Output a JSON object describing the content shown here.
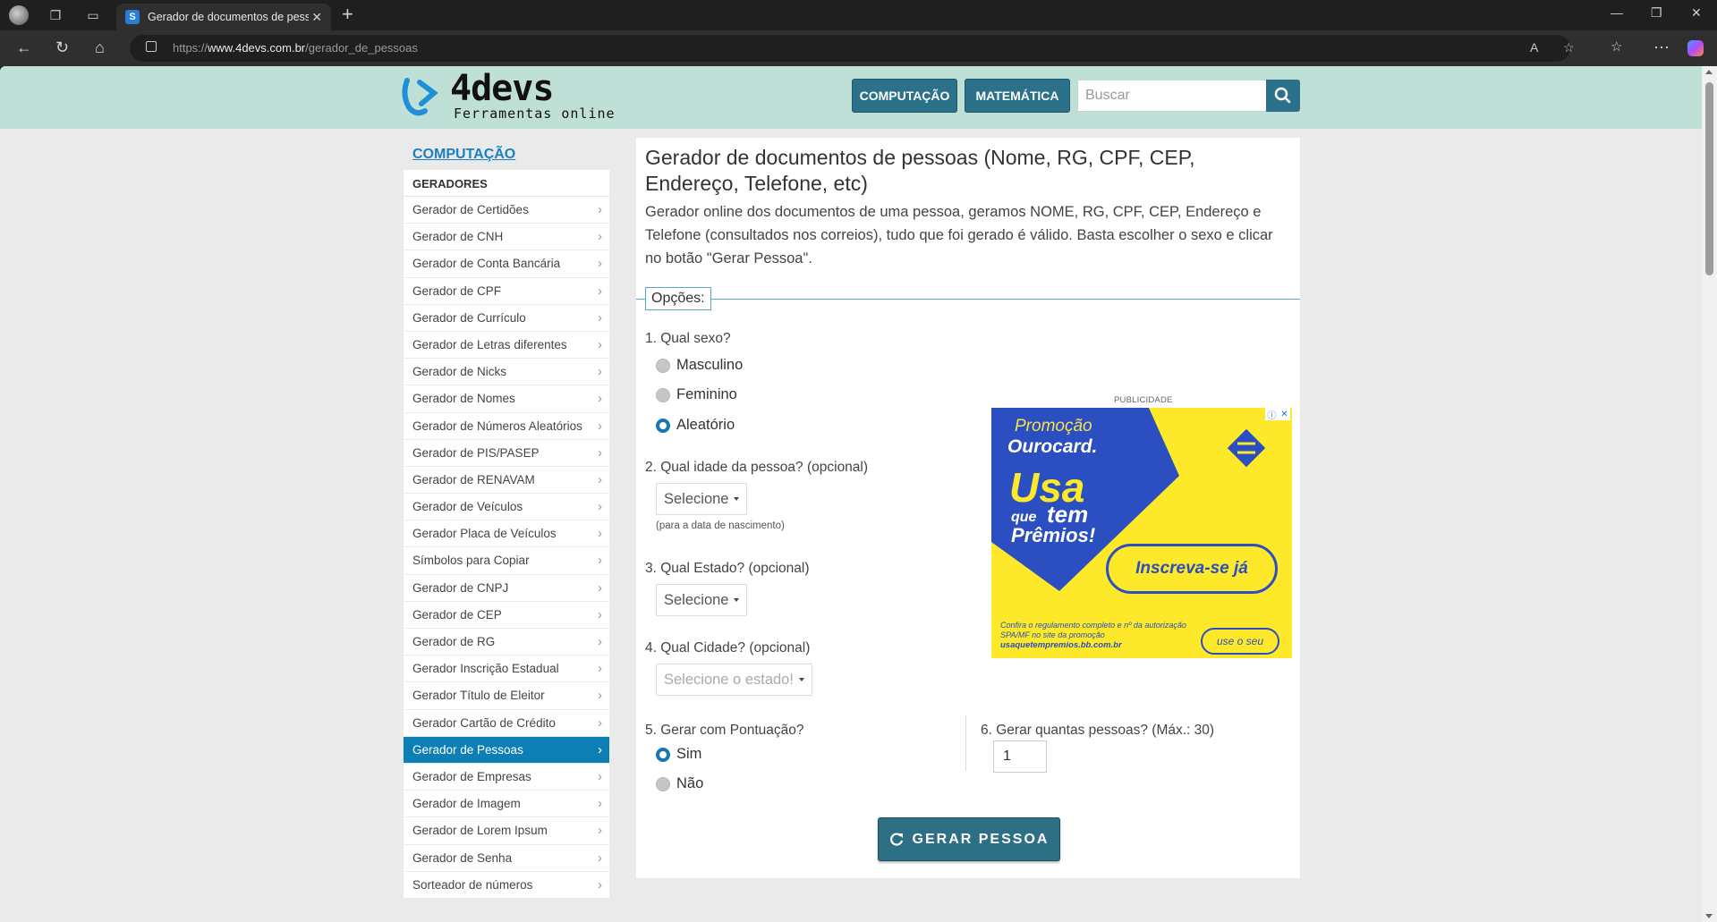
{
  "browser": {
    "tab_title": "Gerador de documentos de pessoas",
    "url_prefix": "https://",
    "url_domain": "www.4devs.com.br",
    "url_path": "/gerador_de_pessoas"
  },
  "header": {
    "logo_name": "4devs",
    "logo_sub": "Ferramentas online",
    "btn_computacao": "COMPUTAÇÃO",
    "btn_matematica": "MATEMÁTICA",
    "search_placeholder": "Buscar"
  },
  "sidebar": {
    "heading": "COMPUTAÇÃO",
    "category": "GERADORES",
    "items": [
      "Gerador de Certidões",
      "Gerador de CNH",
      "Gerador de Conta Bancária",
      "Gerador de CPF",
      "Gerador de Currículo",
      "Gerador de Letras diferentes",
      "Gerador de Nicks",
      "Gerador de Nomes",
      "Gerador de Números Aleatórios",
      "Gerador de PIS/PASEP",
      "Gerador de RENAVAM",
      "Gerador de Veículos",
      "Gerador Placa de Veículos",
      "Símbolos para Copiar",
      "Gerador de CNPJ",
      "Gerador de CEP",
      "Gerador de RG",
      "Gerador Inscrição Estadual",
      "Gerador Título de Eleitor",
      "Gerador Cartão de Crédito",
      "Gerador de Pessoas",
      "Gerador de Empresas",
      "Gerador de Imagem",
      "Gerador de Lorem Ipsum",
      "Gerador de Senha",
      "Sorteador de números"
    ],
    "active_index": 20
  },
  "main": {
    "title": "Gerador de documentos de pessoas (Nome, RG, CPF, CEP, Endereço, Telefone, etc)",
    "description": "Gerador online dos documentos de uma pessoa, geramos NOME, RG, CPF, CEP, Endereço e Telefone (consultados nos correios), tudo que foi gerado é válido. Basta escolher o sexo e clicar no botão \"Gerar Pessoa\".",
    "options_legend": "Opções:",
    "q1": "1. Qual sexo?",
    "sex_options": [
      "Masculino",
      "Feminino",
      "Aleatório"
    ],
    "sex_selected": "Aleatório",
    "q2": "2. Qual idade da pessoa? (opcional)",
    "age_select": "Selecione",
    "age_hint": "(para a data de nascimento)",
    "q3": "3. Qual Estado? (opcional)",
    "state_select": "Selecione",
    "q4": "4. Qual Cidade? (opcional)",
    "city_select": "Selecione o estado!",
    "q5": "5. Gerar com Pontuação?",
    "punct_options": [
      "Sim",
      "Não"
    ],
    "punct_selected": "Sim",
    "q6": "6. Gerar quantas pessoas? (Máx.: 30)",
    "quantity": "1",
    "generate_button": "GERAR PESSOA"
  },
  "ad": {
    "label": "PUBLICIDADE",
    "promo_line1": "Promoção",
    "promo_line2": "Ourocard.",
    "usa": "Usa",
    "que": "que",
    "tem": "tem",
    "premios": "Prêmios!",
    "cta": "Inscreva-se já",
    "footer": "Confira o regulamento completo e nº da autorização SPA/MF no site da promoção",
    "footer_url": "usaquetempremios.bb.com.br",
    "useo": "use o seu",
    "colors": {
      "yellow": "#fde92a",
      "blue": "#2b4fc0"
    }
  },
  "colors": {
    "header_bg": "#bfe0d7",
    "accent": "#2a7189",
    "sidebar_active": "#0e7fb5",
    "link": "#1b7fc3"
  }
}
